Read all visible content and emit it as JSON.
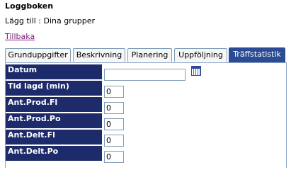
{
  "header": {
    "title": "Loggboken",
    "subtitle": "Lägg till : Dina grupper",
    "back_link": "Tillbaka"
  },
  "tabs": [
    {
      "label": "Grunduppgifter",
      "active": false
    },
    {
      "label": "Beskrivning",
      "active": false
    },
    {
      "label": "Planering",
      "active": false
    },
    {
      "label": "Uppföljning",
      "active": false
    },
    {
      "label": "Träffstatistik",
      "active": true
    }
  ],
  "form": {
    "rows": [
      {
        "label": "Datum",
        "value": ""
      },
      {
        "label": "Tid lagd (min)",
        "value": "0"
      },
      {
        "label": "Ant.Prod.Fl",
        "value": "0"
      },
      {
        "label": "Ant.Prod.Po",
        "value": "0"
      },
      {
        "label": "Ant.Delt.Fl",
        "value": "0"
      },
      {
        "label": "Ant.Delt.Po",
        "value": "0"
      }
    ]
  },
  "colors": {
    "label_bg": "#1d2b6b",
    "active_tab_bg": "#2b4b94",
    "link": "#7a1a7a"
  },
  "icons": {
    "calendar": "calendar-icon"
  }
}
